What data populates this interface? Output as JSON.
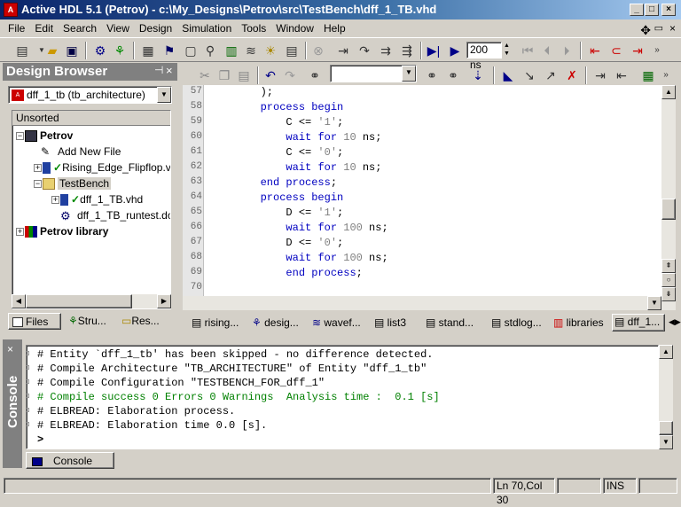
{
  "window": {
    "title": "Active HDL 5.1 (Petrov) - c:\\My_Designs\\Petrov\\src\\TestBench\\dff_1_TB.vhd"
  },
  "menu": [
    "File",
    "Edit",
    "Search",
    "View",
    "Design",
    "Simulation",
    "Tools",
    "Window",
    "Help"
  ],
  "toolbar": {
    "sim_time": "200 ns"
  },
  "design_browser": {
    "title": "Design Browser",
    "combo_value": "dff_1_tb (tb_architecture)",
    "tree_header": "Unsorted",
    "items": [
      {
        "label": "Petrov"
      },
      {
        "label": "Add New File"
      },
      {
        "label": "Rising_Edge_Flipflop.vhd"
      },
      {
        "label": "TestBench"
      },
      {
        "label": "dff_1_TB.vhd"
      },
      {
        "label": "dff_1_TB_runtest.do"
      },
      {
        "label": "Petrov library"
      }
    ],
    "tabs": [
      "Files",
      "Stru...",
      "Res..."
    ]
  },
  "editor": {
    "lines": [
      {
        "n": "57",
        "code": "        );"
      },
      {
        "n": "58",
        "code": "        process begin"
      },
      {
        "n": "59",
        "code": "            C <= '1';"
      },
      {
        "n": "60",
        "code": "            wait for 10 ns;"
      },
      {
        "n": "61",
        "code": "            C <= '0';"
      },
      {
        "n": "62",
        "code": "            wait for 10 ns;"
      },
      {
        "n": "63",
        "code": "        end process;"
      },
      {
        "n": "64",
        "code": "        process begin"
      },
      {
        "n": "65",
        "code": "            D <= '1';"
      },
      {
        "n": "66",
        "code": "            wait for 100 ns;"
      },
      {
        "n": "67",
        "code": "            D <= '0';"
      },
      {
        "n": "68",
        "code": "            wait for 100 ns;"
      },
      {
        "n": "69",
        "code": "            end process;"
      },
      {
        "n": "70",
        "code": ""
      }
    ],
    "tabs": [
      "rising...",
      "desig...",
      "wavef...",
      "list3",
      "stand...",
      "stdlog...",
      "libraries",
      "dff_1..."
    ]
  },
  "console": {
    "label": "Console",
    "lines": [
      {
        "text": "# Entity `dff_1_tb' has been skipped - no difference detected.",
        "color": "#000000"
      },
      {
        "text": "# Compile Architecture \"TB_ARCHITECTURE\" of Entity \"dff_1_tb\"",
        "color": "#000000"
      },
      {
        "text": "# Compile Configuration \"TESTBENCH_FOR_dff_1\"",
        "color": "#000000"
      },
      {
        "text": "# Compile success 0 Errors 0 Warnings  Analysis time :  0.1 [s]",
        "color": "#008000"
      },
      {
        "text": "# ELBREAD: Elaboration process.",
        "color": "#000000"
      },
      {
        "text": "# ELBREAD: Elaboration time 0.0 [s].",
        "color": "#000000"
      }
    ],
    "prompt": ">",
    "tab": "Console"
  },
  "statusbar": {
    "position": "Ln 70,Col 30",
    "mode": "INS"
  }
}
